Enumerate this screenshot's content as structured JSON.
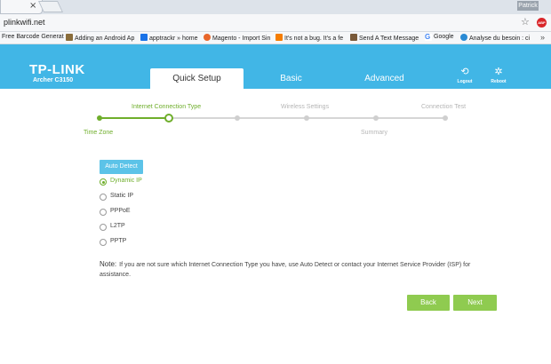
{
  "browser": {
    "tab_close": "×",
    "user_badge": "Patrick",
    "url": "plinkwifi.net",
    "star": "☆",
    "ext_badge": "ABP",
    "bookmarks": [
      {
        "label": "Free Barcode Generat",
        "icon": "page-icon",
        "color": "#9aa0a6"
      },
      {
        "label": "Adding an Android Ap",
        "icon": "android-icon",
        "color": "#8a6d3b"
      },
      {
        "label": "apptrackr » home",
        "icon": "grid-icon",
        "color": "#1a73e8"
      },
      {
        "label": "Magento - Import Sin",
        "icon": "magento-icon",
        "color": "#e8662a"
      },
      {
        "label": "It's not a bug. It's a fe",
        "icon": "blogger-icon",
        "color": "#f57d00"
      },
      {
        "label": "Send A Text Message",
        "icon": "message-icon",
        "color": "#7a5a3a"
      },
      {
        "label": "Google",
        "icon": "google-icon",
        "color": "#4285f4"
      },
      {
        "label": "Analyse du besoin : ci",
        "icon": "analysis-icon",
        "color": "#2a8ad4"
      }
    ],
    "bookmarks_more": "»"
  },
  "header": {
    "brand": "TP-LINK",
    "model": "Archer C3150",
    "tabs": [
      "Quick Setup",
      "Basic",
      "Advanced"
    ],
    "logout": "Logout",
    "reboot": "Reboot"
  },
  "stepper": {
    "top_labels": [
      "Internet Connection Type",
      "Wireless Settings",
      "Connection Test"
    ],
    "bottom_labels": [
      "Time Zone",
      "Summary"
    ]
  },
  "form": {
    "auto_detect": "Auto Detect",
    "options": [
      {
        "label": "Dynamic IP",
        "checked": true
      },
      {
        "label": "Static IP",
        "checked": false
      },
      {
        "label": "PPPoE",
        "checked": false
      },
      {
        "label": "L2TP",
        "checked": false
      },
      {
        "label": "PPTP",
        "checked": false
      }
    ],
    "note_label": "Note:",
    "note_text": "If you are not sure which Internet Connection Type you have, use Auto Detect or contact your Internet Service Provider (ISP) for assistance."
  },
  "buttons": {
    "back": "Back",
    "next": "Next"
  },
  "colors": {
    "header_blue": "#41b6e6",
    "accent_green": "#6fae2b",
    "button_green": "#8fcb50",
    "auto_detect_blue": "#5cc3e8"
  }
}
